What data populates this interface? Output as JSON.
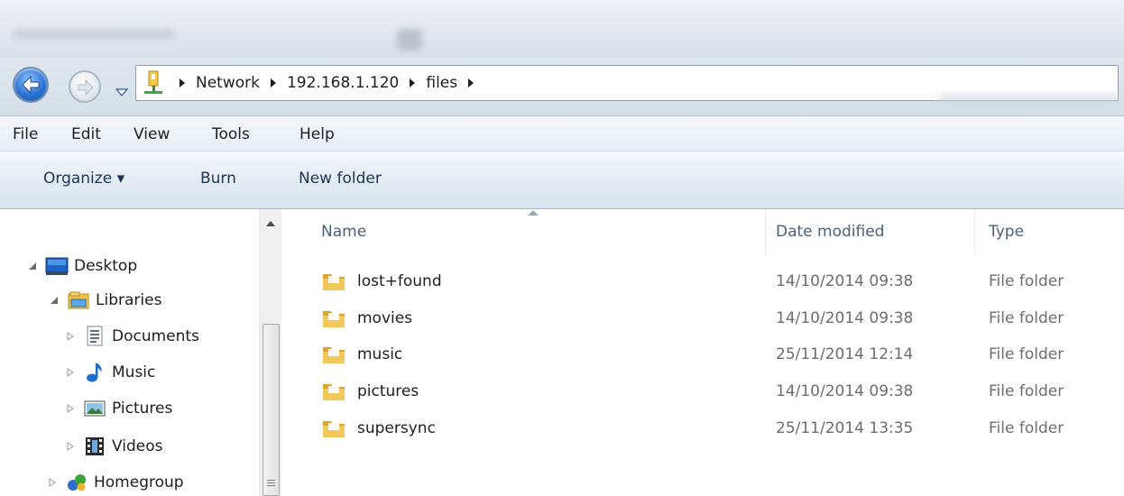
{
  "window": {
    "nav": {
      "back_icon": "back-arrow-icon",
      "forward_icon": "forward-arrow-icon",
      "history_icon": "chevron-down-icon"
    },
    "address": {
      "location_icon": "network-location-icon",
      "crumbs": [
        "Network",
        "192.168.1.120",
        "files"
      ]
    },
    "menu": [
      "File",
      "Edit",
      "View",
      "Tools",
      "Help"
    ],
    "commands": {
      "organize": "Organize ▾",
      "burn": "Burn",
      "new_folder": "New folder"
    },
    "tree": [
      {
        "label": "Desktop",
        "icon": "desktop-icon",
        "expanded": true
      },
      {
        "label": "Libraries",
        "icon": "libraries-icon",
        "expanded": true
      },
      {
        "label": "Documents",
        "icon": "documents-icon",
        "expanded": false
      },
      {
        "label": "Music",
        "icon": "music-icon",
        "expanded": false
      },
      {
        "label": "Pictures",
        "icon": "pictures-icon",
        "expanded": false
      },
      {
        "label": "Videos",
        "icon": "videos-icon",
        "expanded": false
      },
      {
        "label": "Homegroup",
        "icon": "homegroup-icon",
        "expanded": false
      }
    ],
    "columns": {
      "name": "Name",
      "date": "Date modified",
      "type": "Type"
    },
    "files": [
      {
        "name": "lost+found",
        "date": "14/10/2014 09:38",
        "type": "File folder"
      },
      {
        "name": "movies",
        "date": "14/10/2014 09:38",
        "type": "File folder"
      },
      {
        "name": "music",
        "date": "25/11/2014 12:14",
        "type": "File folder"
      },
      {
        "name": "pictures",
        "date": "14/10/2014 09:38",
        "type": "File folder"
      },
      {
        "name": "supersync",
        "date": "25/11/2014 13:35",
        "type": "File folder"
      }
    ],
    "colors": {
      "accent": "#2b74d4",
      "folder": "#e8b640",
      "header_text": "#4c607a",
      "secondary_text": "#6d6d6d"
    }
  }
}
